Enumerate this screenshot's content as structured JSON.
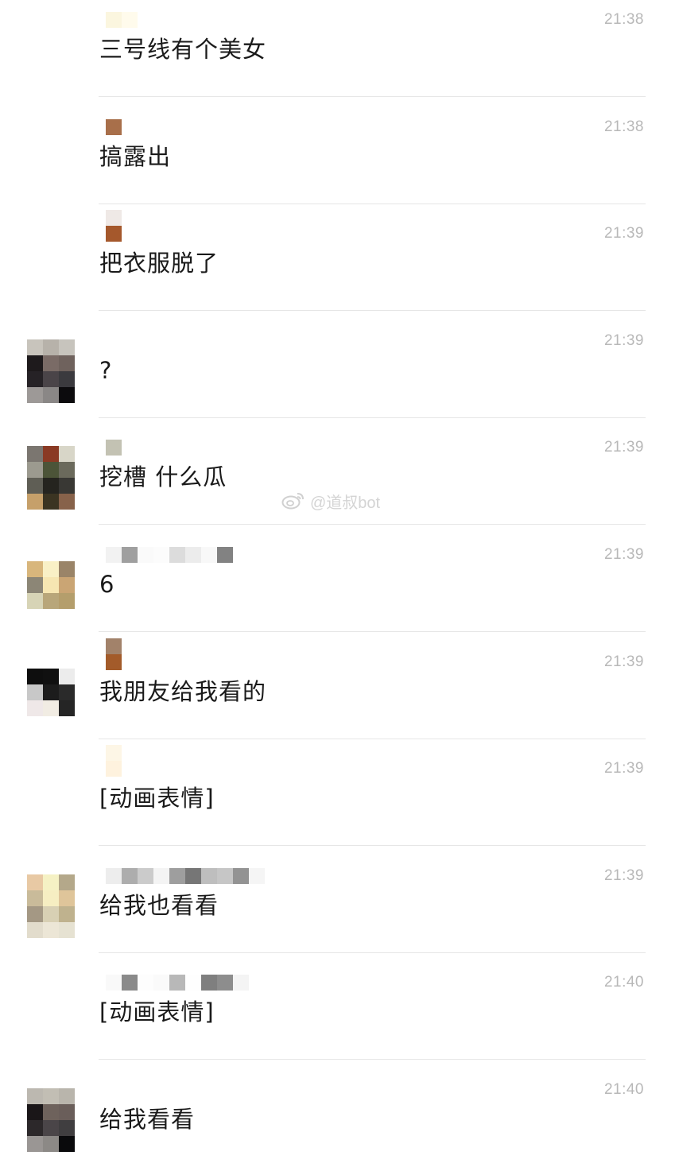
{
  "messages": [
    {
      "sender_blur": true,
      "text": "三号线有个美女",
      "time": "21:38",
      "sender_pixels": [
        [
          "#fbf6df",
          "#fffbec"
        ]
      ]
    },
    {
      "sender_blur": true,
      "text": "搞露出",
      "time": "21:38",
      "sender_pixels": [
        [
          "#a86f4a"
        ]
      ]
    },
    {
      "sender_blur": true,
      "text": "把衣服脱了",
      "time": "21:39",
      "sender_pixels": [
        [
          "#efe9e6"
        ],
        [
          "#a5582c"
        ]
      ]
    },
    {
      "sender_blur": false,
      "text": "?",
      "time": "21:39",
      "avatar_pixels": [
        [
          "#c8c4bc",
          "#b7b2aa",
          "#c7c4bd"
        ],
        [
          "#1e1a1c",
          "#7a6b66",
          "#6f625d"
        ],
        [
          "#262226",
          "#4a4448",
          "#3b3a3e"
        ],
        [
          "#9d9997",
          "#8a8786",
          "#0c0b0d"
        ]
      ]
    },
    {
      "sender_blur": true,
      "text": "挖槽 什么瓜",
      "time": "21:39",
      "sender_pixels": [
        [
          "#c3c2b3"
        ]
      ],
      "avatar_pixels": [
        [
          "#7b7670",
          "#8a3a24",
          "#d8d6c8"
        ],
        [
          "#9c9a8f",
          "#4c5438",
          "#6b6a5c"
        ],
        [
          "#5f5e55",
          "#25241f",
          "#393834"
        ],
        [
          "#c6a06a",
          "#3b3422",
          "#87624a"
        ]
      ]
    },
    {
      "sender_blur": true,
      "text": "6",
      "time": "21:39",
      "sender_pixels": [
        [
          "#f2f2f2",
          "#9f9f9f",
          "#fafafa",
          "#fcfcfc",
          "#dcdcdc",
          "#ececec",
          "#f8f8f8",
          "#828282"
        ]
      ],
      "avatar_pixels": [
        [
          "#d8b67c",
          "#f9f0c6",
          "#9a8468"
        ],
        [
          "#8c8676",
          "#f6e6b2",
          "#caa574"
        ],
        [
          "#d7d4b6",
          "#b8a67a",
          "#b49e6c"
        ]
      ]
    },
    {
      "sender_blur": true,
      "text": "我朋友给我看的",
      "time": "21:39",
      "sender_pixels": [
        [
          "#a2826a"
        ],
        [
          "#a35b2a"
        ]
      ],
      "avatar_pixels": [
        [
          "#0e0e0e",
          "#101010",
          "#ececec"
        ],
        [
          "#c8c8c8",
          "#1c1c1c",
          "#2a2a2a"
        ],
        [
          "#efe8e8",
          "#f1ece3",
          "#252525"
        ]
      ]
    },
    {
      "sender_blur": true,
      "text": "[动画表情]",
      "time": "21:39",
      "sender_pixels": [
        [
          "#fdf6e6"
        ],
        [
          "#fef2de"
        ]
      ]
    },
    {
      "sender_blur": true,
      "text": "给我也看看",
      "time": "21:39",
      "sender_pixels": [
        [
          "#ededed",
          "#adadad",
          "#cbcbcb",
          "#f4f4f4",
          "#9e9e9e",
          "#767676",
          "#bebebe",
          "#c6c6c6",
          "#939393",
          "#f5f5f5"
        ]
      ],
      "avatar_pixels": [
        [
          "#e8c9a4",
          "#f5f1c4",
          "#b4a88a"
        ],
        [
          "#c9bb9a",
          "#f6eec2",
          "#dfc59a"
        ],
        [
          "#a49884",
          "#d8d0b4",
          "#bfb28e"
        ],
        [
          "#e2dccc",
          "#ece6d6",
          "#e6e2d2"
        ]
      ]
    },
    {
      "sender_blur": true,
      "text": "[动画表情]",
      "time": "21:40",
      "sender_pixels": [
        [
          "#f9f9f9",
          "#8a8a8a",
          "#fdfdfd",
          "#fafafa",
          "#b8b8b8",
          "#fefefe",
          "#7f7f7f",
          "#8d8d8d",
          "#f4f4f4"
        ]
      ]
    },
    {
      "sender_blur": false,
      "text": "给我看看",
      "time": "21:40",
      "avatar_pixels": [
        [
          "#bcb8b0",
          "#c2beb4",
          "#b9b5ac"
        ],
        [
          "#1a1618",
          "#6e625c",
          "#6a5e5a"
        ],
        [
          "#2c282a",
          "#4a4548",
          "#403e40"
        ],
        [
          "#9a9694",
          "#8c8986",
          "#0a0a0c"
        ]
      ]
    }
  ],
  "watermark": {
    "text": "@道叔bot",
    "icon": "weibo-logo-icon"
  }
}
